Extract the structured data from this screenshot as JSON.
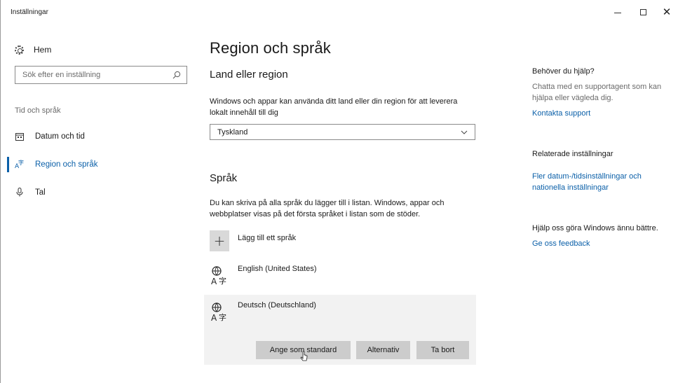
{
  "window": {
    "title": "Inställningar",
    "minimize_glyph": "–",
    "maximize_glyph": "☐",
    "close_glyph": "✕"
  },
  "sidebar": {
    "home_label": "Hem",
    "search_placeholder": "Sök efter en inställning",
    "section_label": "Tid och språk",
    "items": [
      {
        "label": "Datum och tid",
        "icon": "calendar-icon"
      },
      {
        "label": "Region och språk",
        "icon": "region-language-icon",
        "active": true
      },
      {
        "label": "Tal",
        "icon": "microphone-icon"
      }
    ]
  },
  "main": {
    "title": "Region och språk",
    "country": {
      "heading": "Land eller region",
      "description": "Windows och appar kan använda ditt land eller din region för att leverera lokalt innehåll till dig",
      "selected": "Tyskland"
    },
    "language": {
      "heading": "Språk",
      "description": "Du kan skriva på alla språk du lägger till i listan. Windows, appar och webbplatser visas på det första språket i listan som de stöder.",
      "add_label": "Lägg till ett språk",
      "languages": [
        {
          "name": "English (United States)"
        },
        {
          "name": "Deutsch (Deutschland)",
          "selected": true
        }
      ],
      "buttons": {
        "set_default": "Ange som standard",
        "options": "Alternativ",
        "remove": "Ta bort"
      }
    }
  },
  "right": {
    "help": {
      "heading": "Behöver du hjälp?",
      "text": "Chatta med en supportagent som kan hjälpa eller vägleda dig.",
      "link": "Kontakta support"
    },
    "related": {
      "heading": "Relaterade inställningar",
      "link": "Fler datum-/tidsinställningar och nationella inställningar"
    },
    "feedback": {
      "heading": "Hjälp oss göra Windows ännu bättre.",
      "link": "Ge oss feedback"
    }
  },
  "colors": {
    "accent": "#0a5fa8",
    "button_bg": "#cccccc",
    "selected_bg": "#f2f2f2"
  }
}
